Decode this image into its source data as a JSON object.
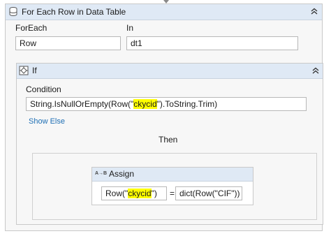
{
  "foreach": {
    "title": "For Each Row in Data Table",
    "foreach_label": "ForEach",
    "foreach_value": "Row",
    "in_label": "In",
    "in_value": "dt1"
  },
  "if_block": {
    "title": "If",
    "condition_label": "Condition",
    "condition_prefix": "String.IsNullOrEmpty(Row(\"",
    "condition_highlight": "ckycid",
    "condition_suffix": "\").ToString.Trim)",
    "show_else": "Show Else",
    "then_label": "Then"
  },
  "assign": {
    "title": "Assign",
    "icon_text": "A→B",
    "to_prefix": "Row(\"",
    "to_highlight": "ckycid",
    "to_suffix": "\")",
    "equals": "=",
    "value": "dict(Row(\"CIF\"))"
  },
  "colors": {
    "header_bg": "#dfe9f5",
    "highlight": "#ffff00",
    "link": "#1f6fb4"
  }
}
